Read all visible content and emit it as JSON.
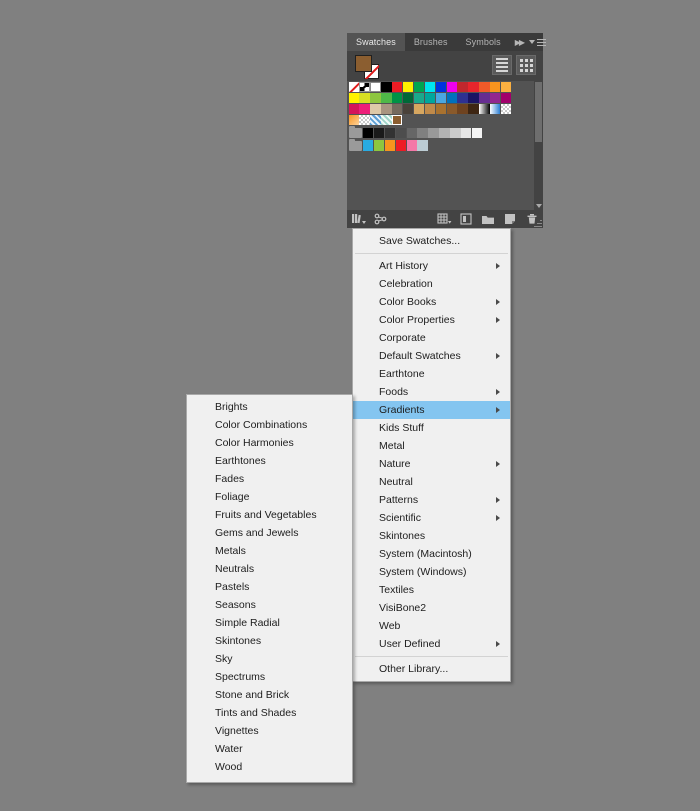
{
  "app": {
    "background_color": "#808080"
  },
  "swatches_panel": {
    "tabs": [
      {
        "label": "Swatches",
        "active": true
      },
      {
        "label": "Brushes",
        "active": false
      },
      {
        "label": "Symbols",
        "active": false
      }
    ],
    "collapse_icon": "double-chevron-right-icon",
    "panel_menu_icon": "panel-menu-icon",
    "fill_color": "#8b5e30",
    "stroke_color": "#ffffff",
    "view_buttons": [
      {
        "name": "list-view-button",
        "icon": "list-view-icon"
      },
      {
        "name": "grid-view-button",
        "icon": "grid-view-icon"
      }
    ],
    "footer_buttons": [
      {
        "name": "swatch-libraries-menu-button",
        "icon": "swatch-libraries-icon"
      },
      {
        "name": "show-swatch-kinds-menu-button",
        "icon": "show-swatch-kinds-icon"
      },
      {
        "name": "swatch-options-button",
        "icon": "swatch-options-icon"
      },
      {
        "name": "new-color-group-button",
        "icon": "new-color-group-icon"
      },
      {
        "name": "new-swatch-button",
        "icon": "new-swatch-icon"
      },
      {
        "name": "delete-swatch-button",
        "icon": "trash-icon"
      }
    ],
    "swatch_rows": [
      [
        "none",
        "registration",
        "#ffffff",
        "#000000",
        "#ed1c24",
        "#fff200",
        "#00a651",
        "#00aeef",
        "#2e3192",
        "#ec008c",
        "#c1272d",
        "#ed1c24",
        "#f15a29",
        "#f7941e",
        "#fbb040",
        "#2b2b2b",
        "#2b2b2b"
      ],
      [
        "#fff200",
        "#d7df23",
        "#8dc63f",
        "#39b54a",
        "#009245",
        "#006837",
        "#00a99d",
        "#00a79d",
        "#29abe2",
        "#0071bc",
        "#2e3192",
        "#1b1464",
        "#662d91",
        "#92278f",
        "#a1006b",
        "#2b2b2b",
        "#2b2b2b"
      ],
      [
        "#d4145a",
        "#ed1e79",
        "#d9c6a5",
        "#a6917c",
        "#756a5e",
        "#4a423a",
        "#d2a15c",
        "#c08a4a",
        "#a9722f",
        "#8a5a2b",
        "#6f4320",
        "#4a2c14",
        "gradient-white-black",
        "gradient-blue",
        "checker-pink",
        "#2b2b2b",
        "#2b2b2b"
      ],
      [
        "#f7941e",
        "checker-light",
        "pattern-blue",
        "pattern-mint",
        "#8b5e30-sel"
      ],
      [
        "#000000",
        "#1a1a1a",
        "#333333",
        "#4d4d4d",
        "#666666",
        "#808080",
        "#999999",
        "#b3b3b3",
        "#cccccc",
        "#e6e6e6",
        "#f2f2f2"
      ],
      [
        "#29abe2",
        "#8dc63f",
        "#f7941e",
        "#ed1c24",
        "#f478a7",
        "#bcccd4"
      ]
    ]
  },
  "context_menu": {
    "items": [
      {
        "label": "Save Swatches...",
        "submenu": false
      },
      {
        "separator": true
      },
      {
        "label": "Art History",
        "submenu": true
      },
      {
        "label": "Celebration",
        "submenu": false
      },
      {
        "label": "Color Books",
        "submenu": true
      },
      {
        "label": "Color Properties",
        "submenu": true
      },
      {
        "label": "Corporate",
        "submenu": false
      },
      {
        "label": "Default Swatches",
        "submenu": true
      },
      {
        "label": "Earthtone",
        "submenu": false
      },
      {
        "label": "Foods",
        "submenu": true
      },
      {
        "label": "Gradients",
        "submenu": true,
        "selected": true
      },
      {
        "label": "Kids Stuff",
        "submenu": false
      },
      {
        "label": "Metal",
        "submenu": false
      },
      {
        "label": "Nature",
        "submenu": true
      },
      {
        "label": "Neutral",
        "submenu": false
      },
      {
        "label": "Patterns",
        "submenu": true
      },
      {
        "label": "Scientific",
        "submenu": true
      },
      {
        "label": "Skintones",
        "submenu": false
      },
      {
        "label": "System (Macintosh)",
        "submenu": false
      },
      {
        "label": "System (Windows)",
        "submenu": false
      },
      {
        "label": "Textiles",
        "submenu": false
      },
      {
        "label": "VisiBone2",
        "submenu": false
      },
      {
        "label": "Web",
        "submenu": false
      },
      {
        "label": "User Defined",
        "submenu": true
      },
      {
        "separator": true
      },
      {
        "label": "Other Library...",
        "submenu": false
      }
    ],
    "highlight_color": "#84c5f0"
  },
  "submenu": {
    "parent": "Gradients",
    "items": [
      {
        "label": "Brights"
      },
      {
        "label": "Color Combinations"
      },
      {
        "label": "Color Harmonies"
      },
      {
        "label": "Earthtones"
      },
      {
        "label": "Fades"
      },
      {
        "label": "Foliage"
      },
      {
        "label": "Fruits and Vegetables"
      },
      {
        "label": "Gems and Jewels"
      },
      {
        "label": "Metals"
      },
      {
        "label": "Neutrals"
      },
      {
        "label": "Pastels"
      },
      {
        "label": "Seasons"
      },
      {
        "label": "Simple Radial"
      },
      {
        "label": "Skintones"
      },
      {
        "label": "Sky"
      },
      {
        "label": "Spectrums"
      },
      {
        "label": "Stone and Brick"
      },
      {
        "label": "Tints and Shades"
      },
      {
        "label": "Vignettes"
      },
      {
        "label": "Water"
      },
      {
        "label": "Wood"
      }
    ]
  }
}
